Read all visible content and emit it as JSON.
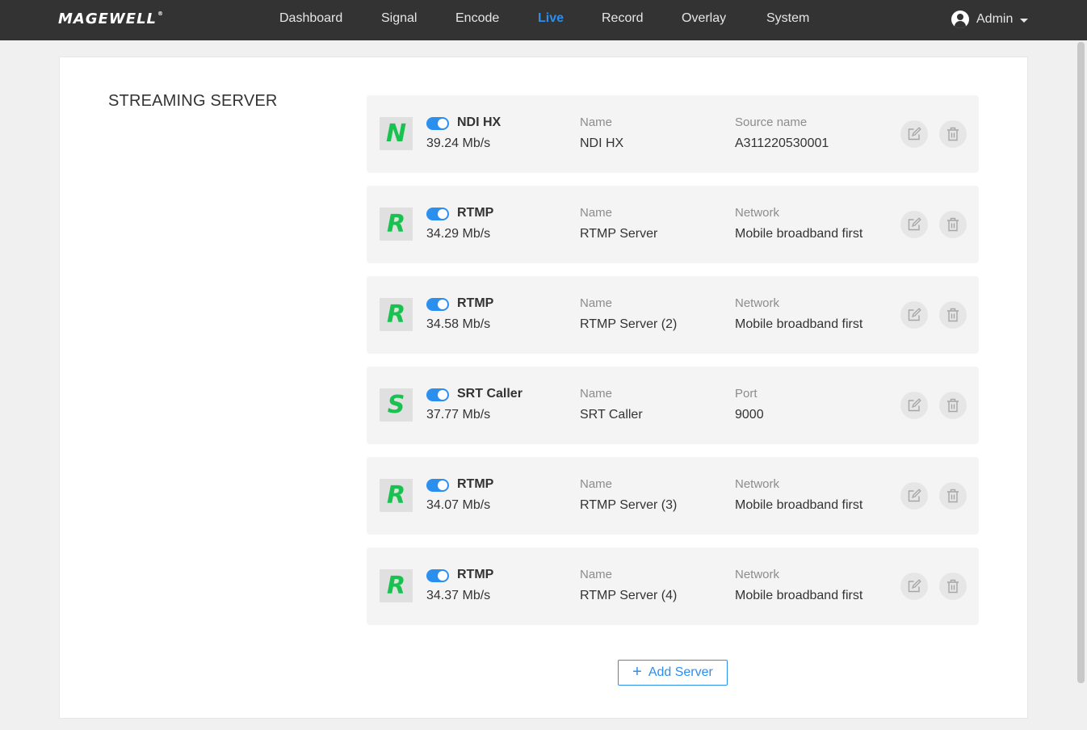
{
  "brand": {
    "logo": "MAGEWELL",
    "trademark": "®"
  },
  "nav": [
    {
      "label": "Dashboard",
      "active": false
    },
    {
      "label": "Signal",
      "active": false
    },
    {
      "label": "Encode",
      "active": false
    },
    {
      "label": "Live",
      "active": true
    },
    {
      "label": "Record",
      "active": false
    },
    {
      "label": "Overlay",
      "active": false
    },
    {
      "label": "System",
      "active": false
    }
  ],
  "user": {
    "name": "Admin"
  },
  "section": {
    "title": "STREAMING SERVER"
  },
  "servers": [
    {
      "badge": "N",
      "enabled": true,
      "type": "NDI HX",
      "rate": "39.24 Mb/s",
      "name_label": "Name",
      "name": "NDI HX",
      "extra_label": "Source name",
      "extra_value": "A311220530001"
    },
    {
      "badge": "R",
      "enabled": true,
      "type": "RTMP",
      "rate": "34.29 Mb/s",
      "name_label": "Name",
      "name": "RTMP Server",
      "extra_label": "Network",
      "extra_value": "Mobile broadband first"
    },
    {
      "badge": "R",
      "enabled": true,
      "type": "RTMP",
      "rate": "34.58 Mb/s",
      "name_label": "Name",
      "name": "RTMP Server (2)",
      "extra_label": "Network",
      "extra_value": "Mobile broadband first"
    },
    {
      "badge": "S",
      "enabled": true,
      "type": "SRT Caller",
      "rate": "37.77 Mb/s",
      "name_label": "Name",
      "name": "SRT Caller",
      "extra_label": "Port",
      "extra_value": "9000"
    },
    {
      "badge": "R",
      "enabled": true,
      "type": "RTMP",
      "rate": "34.07 Mb/s",
      "name_label": "Name",
      "name": "RTMP Server (3)",
      "extra_label": "Network",
      "extra_value": "Mobile broadband first"
    },
    {
      "badge": "R",
      "enabled": true,
      "type": "RTMP",
      "rate": "34.37 Mb/s",
      "name_label": "Name",
      "name": "RTMP Server (4)",
      "extra_label": "Network",
      "extra_value": "Mobile broadband first"
    }
  ],
  "actions": {
    "add_server": "Add Server"
  },
  "colors": {
    "topbar": "#333333",
    "accent": "#2b8ff0",
    "badge_letter": "#18c24f",
    "card_bg": "#f4f4f4"
  },
  "icons": {
    "edit": "edit-icon",
    "delete": "trash-icon",
    "add": "plus-icon",
    "user": "user-icon",
    "dropdown": "chevron-down-icon"
  }
}
